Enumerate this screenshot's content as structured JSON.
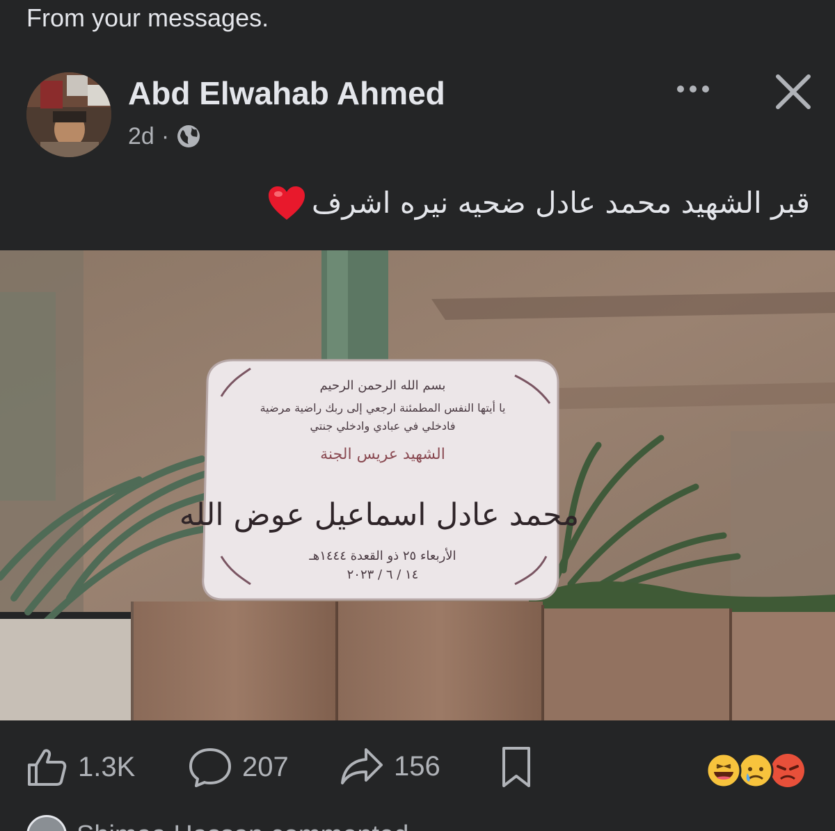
{
  "header": {
    "section_label": "From your messages."
  },
  "post": {
    "author": "Abd Elwahab Ahmed",
    "time": "2d",
    "separator": "·",
    "audience_icon": "globe-icon",
    "caption": "قبر الشهيد محمد عادل ضحيه نيره اشرف",
    "caption_emoji": "red-heart",
    "photo": {
      "subject": "grave marker plaque",
      "plaque_lines": [
        "بسم الله الرحمن الرحيم",
        "يا أيتها النفس المطمئنة ارجعي إلى ربك راضية مرضية",
        "فادخلي في عبادي وادخلي جنتي",
        "الشهيد عريس الجنة",
        "محمد عادل اسماعيل عوض الله",
        "الأربعاء ٢٥ ذو القعدة ١٤٤٤هـ",
        "١٤ / ٦ / ٢٠٢٣"
      ]
    }
  },
  "actions": {
    "like": {
      "icon": "thumbs-up-icon",
      "count": "1.3K"
    },
    "comment": {
      "icon": "comment-bubble-icon",
      "count": "207"
    },
    "share": {
      "icon": "share-arrow-icon",
      "count": "156"
    },
    "save": {
      "icon": "bookmark-icon"
    }
  },
  "reactions": [
    "haha-emoji",
    "sad-emoji",
    "angry-emoji"
  ],
  "next_comment": {
    "preview": "Shimaa Hassan commented"
  },
  "colors": {
    "background": "#242526",
    "primary_text": "#e4e6eb",
    "secondary_text": "#b0b3b8"
  }
}
